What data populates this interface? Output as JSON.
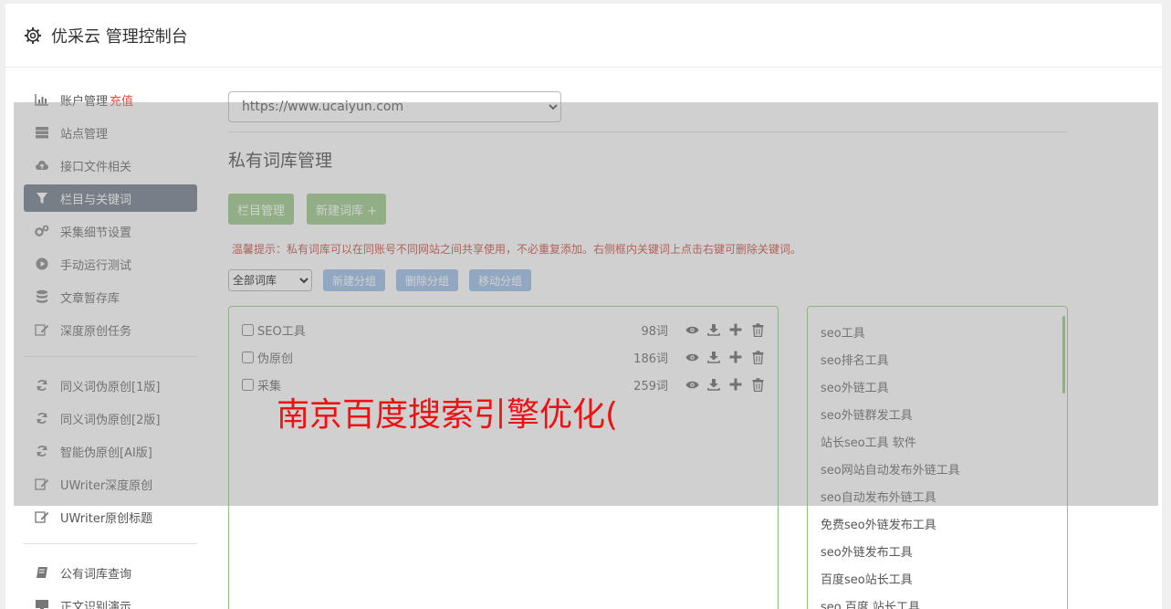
{
  "header": {
    "title": "优采云 管理控制台"
  },
  "sidebar": {
    "group1": [
      {
        "label": "账户管理",
        "extra": "充值",
        "icon": "bar-chart-icon"
      },
      {
        "label": "站点管理",
        "icon": "server-icon"
      },
      {
        "label": "接口文件相关",
        "icon": "cloud-upload-icon"
      },
      {
        "label": "栏目与关键词",
        "icon": "filter-icon"
      },
      {
        "label": "采集细节设置",
        "icon": "cogs-icon"
      },
      {
        "label": "手动运行测试",
        "icon": "play-icon"
      },
      {
        "label": "文章暂存库",
        "icon": "database-icon"
      },
      {
        "label": "深度原创任务",
        "icon": "edit-icon"
      }
    ],
    "group2": [
      {
        "label": "同义词伪原创[1版]",
        "icon": "refresh-icon"
      },
      {
        "label": "同义词伪原创[2版]",
        "icon": "refresh-icon"
      },
      {
        "label": "智能伪原创[AI版]",
        "icon": "refresh-icon"
      },
      {
        "label": "UWriter深度原创",
        "icon": "edit-icon"
      },
      {
        "label": "UWriter原创标题",
        "icon": "edit-icon"
      }
    ],
    "group3": [
      {
        "label": "公有词库查询",
        "icon": "book-icon"
      },
      {
        "label": "正文识别演示",
        "icon": "monitor-icon"
      }
    ],
    "active_index": 3
  },
  "main": {
    "site_select": "https://www.ucaiyun.com",
    "page_title": "私有词库管理",
    "btn_column": "栏目管理",
    "btn_new_lib": "新建词库 +",
    "tip": "温馨提示：私有词库可以在同账号不同网站之间共享使用，不必重复添加。右侧框内关键词上点击右键可删除关键词。",
    "group_select": "全部词库",
    "btn_new_group": "新建分组",
    "btn_delete_group": "删除分组",
    "btn_move_group": "移动分组",
    "libraries": [
      {
        "name": "SEO工具",
        "count": "98词"
      },
      {
        "name": "伪原创",
        "count": "186词"
      },
      {
        "name": "采集",
        "count": "259词"
      }
    ],
    "keywords": [
      "seo工具",
      "seo排名工具",
      "seo外链工具",
      "seo外链群发工具",
      "站长seo工具 软件",
      "seo网站自动发布外链工具",
      "seo自动发布外链工具",
      "免费seo外链发布工具",
      "seo外链发布工具",
      "百度seo站长工具",
      "seo 百度 站长工具"
    ]
  },
  "overlay": {
    "promo_text": "南京百度搜索引擎优化("
  },
  "colors": {
    "accent_green": "#8dc27a",
    "accent_blue": "#8fb6e6",
    "active_nav": "#5f6b7a",
    "promo_red": "#ee1111",
    "tip_red": "#c0392b"
  }
}
